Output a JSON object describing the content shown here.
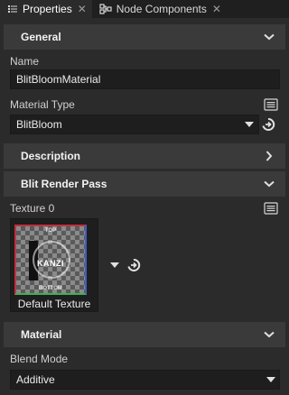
{
  "tabs": [
    {
      "label": "Properties",
      "active": true
    },
    {
      "label": "Node Components",
      "active": false
    }
  ],
  "sections": {
    "general": "General",
    "description": "Description",
    "blit_render_pass": "Blit Render Pass",
    "material": "Material"
  },
  "properties": {
    "name_label": "Name",
    "name_value": "BlitBloomMaterial",
    "material_type_label": "Material Type",
    "material_type_value": "BlitBloom",
    "texture0_label": "Texture 0",
    "texture0_value": "Default Texture",
    "blend_mode_label": "Blend Mode",
    "blend_mode_value": "Additive"
  },
  "thumbnail": {
    "top": "TOP",
    "bottom": "BOTTOM",
    "logo": "KANZI"
  },
  "icons": {
    "properties_tab": "properties-panel-icon",
    "node_components_tab": "node-components-icon",
    "close": "close-icon",
    "collapse": "chevron-down-icon",
    "expand": "chevron-right-icon",
    "edit": "edit-icon",
    "goto": "goto-icon",
    "dropdown": "dropdown-arrow-icon"
  },
  "colors": {
    "background": "#2b2b2b",
    "header": "#3a3a3a",
    "field": "#1e1e1e",
    "tabbar": "#1f1f1f"
  }
}
